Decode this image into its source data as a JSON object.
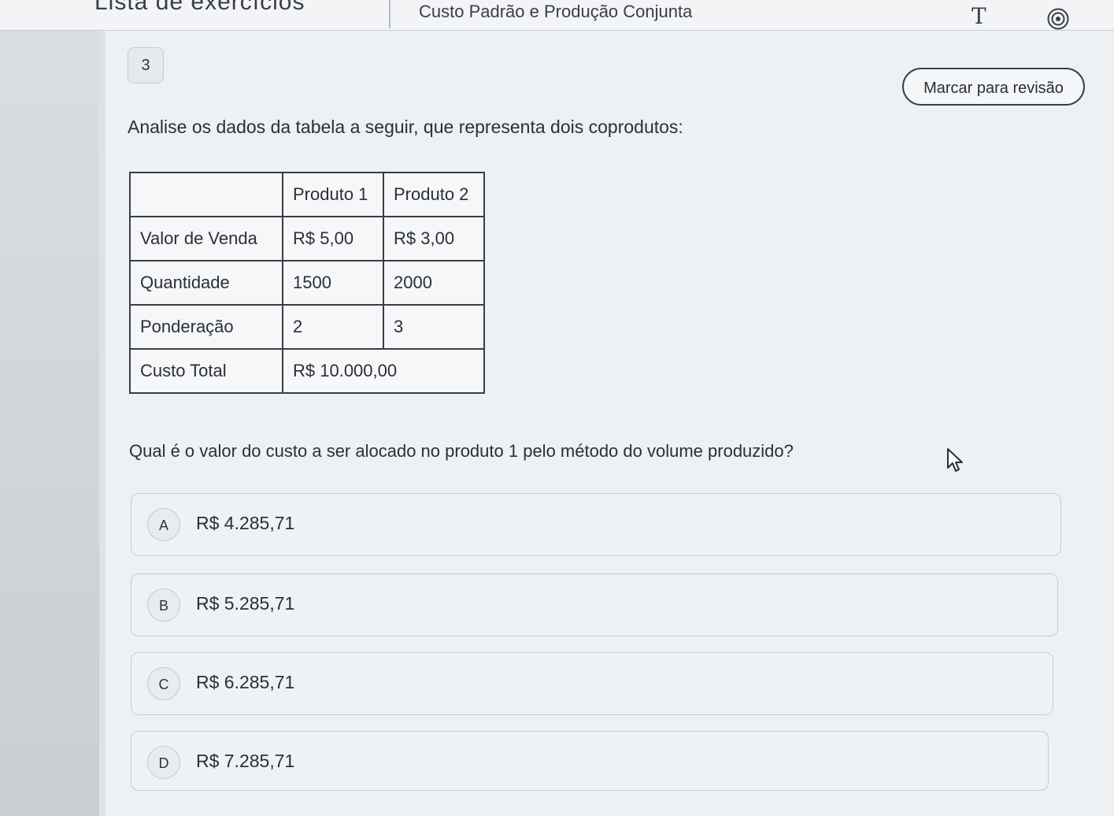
{
  "top_bar": {
    "left_text": "Lista de exercícios",
    "title": "Custo Padrão e Produção Conjunta",
    "text_size_glyph": "T",
    "icons": [
      "text-size-icon",
      "target-icon"
    ]
  },
  "question": {
    "number": "3",
    "review_label": "Marcar para revisão",
    "prompt": "Analise os dados da tabela a seguir, que representa dois coprodutos:",
    "text": "Qual é o valor do custo a ser alocado no produto 1 pelo método do volume produzido?"
  },
  "table": {
    "headers": [
      "",
      "Produto 1",
      "Produto 2"
    ],
    "rows": [
      [
        "Valor de Venda",
        "R$ 5,00",
        "R$ 3,00"
      ],
      [
        "Quantidade",
        "1500",
        "2000"
      ],
      [
        "Ponderação",
        "2",
        "3"
      ],
      [
        "Custo Total",
        "R$ 10.000,00"
      ]
    ]
  },
  "options": [
    {
      "letter": "A",
      "text": "R$ 4.285,71"
    },
    {
      "letter": "B",
      "text": "R$ 5.285,71"
    },
    {
      "letter": "C",
      "text": "R$ 6.285,71"
    },
    {
      "letter": "D",
      "text": "R$ 7.285,71"
    }
  ],
  "colors": {
    "background": "#eef1f4",
    "border": "#3a3e44",
    "text": "#2b2f36"
  }
}
